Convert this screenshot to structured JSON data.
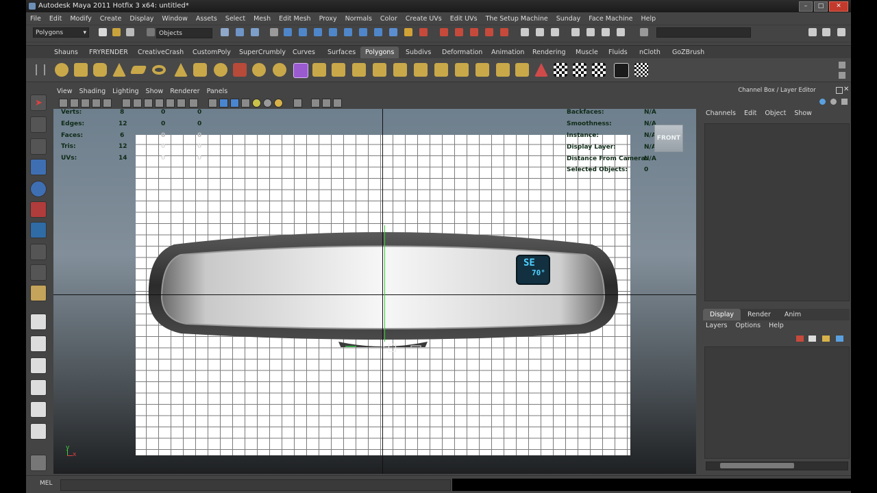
{
  "window": {
    "title": "Autodesk Maya 2011 Hotfix 3 x64: untitled*",
    "buttons": [
      "–",
      "□",
      "✕"
    ]
  },
  "menubar": [
    "File",
    "Edit",
    "Modify",
    "Create",
    "Display",
    "Window",
    "Assets",
    "Select",
    "Mesh",
    "Edit Mesh",
    "Proxy",
    "Normals",
    "Color",
    "Create UVs",
    "Edit UVs",
    "The Setup Machine",
    "Sunday",
    "Face Machine",
    "Help"
  ],
  "statusline": {
    "menu_set": "Polygons",
    "selection_mode": "Objects"
  },
  "shelf_tabs": [
    "Shauns",
    "FRYRENDER",
    "CreativeCrash",
    "CustomPoly",
    "SuperCrumbly",
    "Curves",
    "Surfaces",
    "Polygons",
    "Subdivs",
    "Deformation",
    "Animation",
    "Rendering",
    "Muscle",
    "Fluids",
    "nCloth",
    "GoZBrush"
  ],
  "active_shelf_tab": "Polygons",
  "panel_menu": [
    "View",
    "Shading",
    "Lighting",
    "Show",
    "Renderer",
    "Panels"
  ],
  "hud": {
    "left_rows": [
      {
        "label": "Verts:",
        "v1": "8",
        "v2": "0",
        "v3": "0"
      },
      {
        "label": "Edges:",
        "v1": "12",
        "v2": "0",
        "v3": "0"
      },
      {
        "label": "Faces:",
        "v1": "6",
        "v2": "0",
        "v3": "0"
      },
      {
        "label": "Tris:",
        "v1": "12",
        "v2": "0",
        "v3": "0"
      },
      {
        "label": "UVs:",
        "v1": "14",
        "v2": "0",
        "v3": "0"
      }
    ],
    "right_rows": [
      {
        "label": "Backfaces:",
        "value": "N/A"
      },
      {
        "label": "Smoothness:",
        "value": "N/A"
      },
      {
        "label": "Instance:",
        "value": "N/A"
      },
      {
        "label": "Display Layer:",
        "value": "N/A"
      },
      {
        "label": "Distance From Camera:",
        "value": "N/A"
      },
      {
        "label": "Selected Objects:",
        "value": "0"
      }
    ],
    "view_cube": "FRONT",
    "axis_y": "y",
    "axis_x": "x"
  },
  "mirror_display": {
    "top": "SE",
    "bottom": "70°"
  },
  "command_line": {
    "label": "MEL"
  },
  "channel_box": {
    "title": "Channel Box / Layer Editor",
    "menu": [
      "Channels",
      "Edit",
      "Object",
      "Show"
    ]
  },
  "layer_editor": {
    "tabs": [
      "Display",
      "Render",
      "Anim"
    ],
    "active_tab": "Display",
    "menu": [
      "Layers",
      "Options",
      "Help"
    ]
  },
  "colors": {
    "ui_bg": "#444444",
    "hud_text": "#0e2a16",
    "mirror_display_text": "#4fd0ff",
    "axis_green": "#3bd23b"
  }
}
